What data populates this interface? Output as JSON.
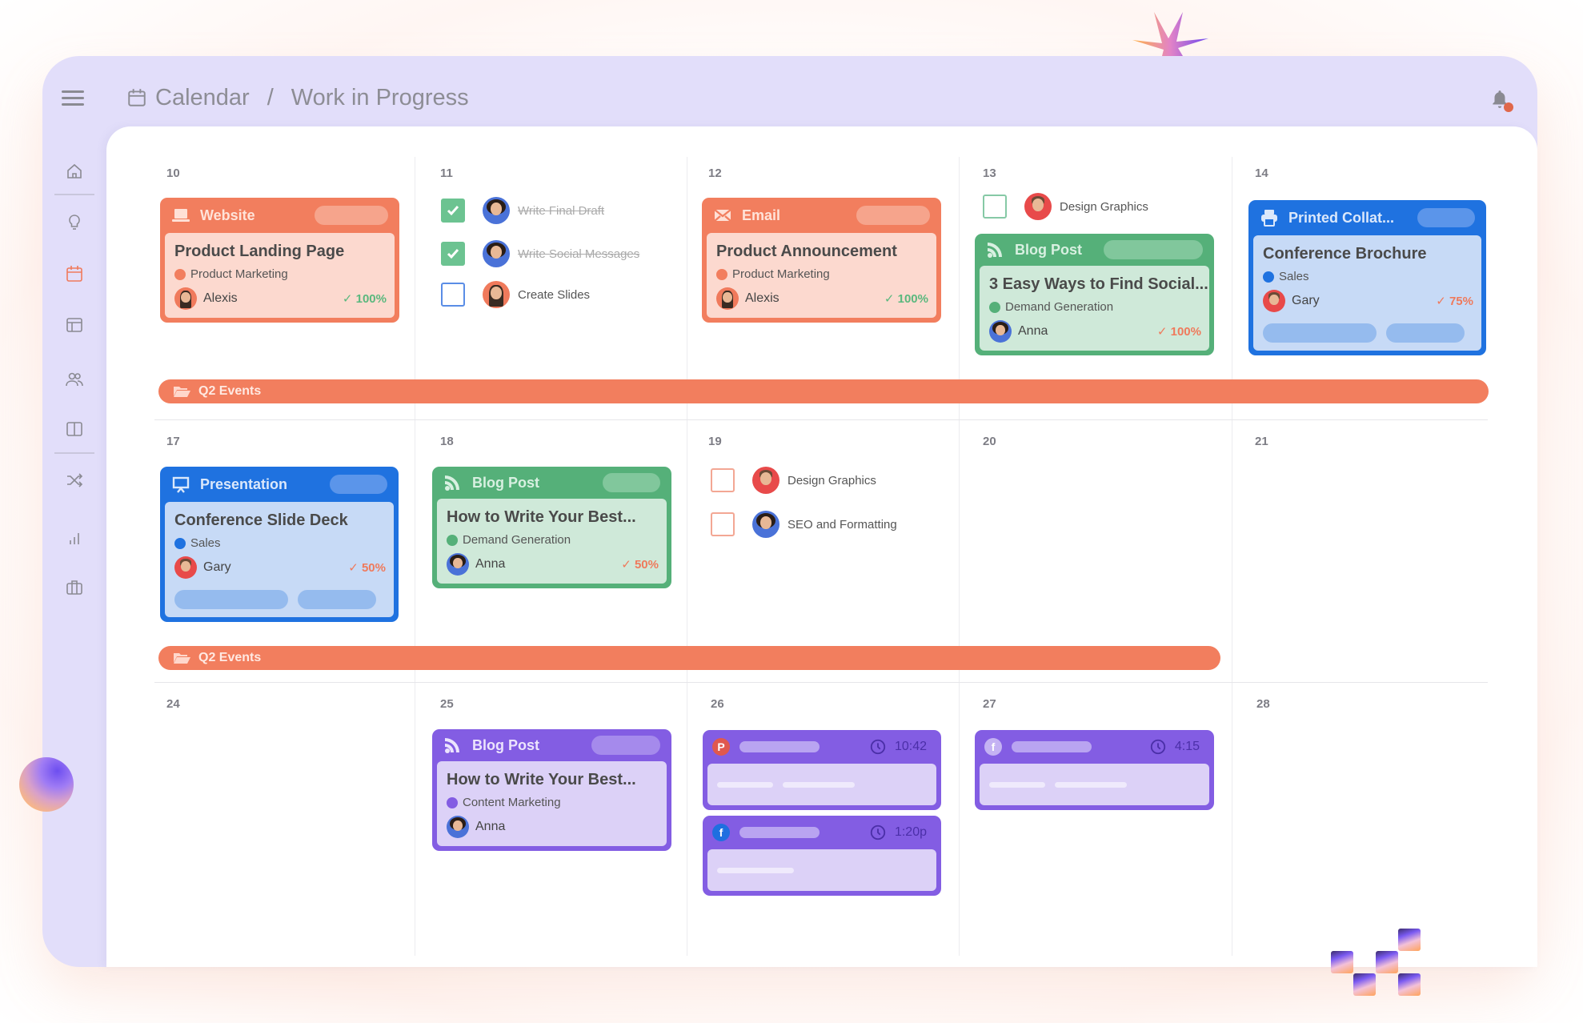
{
  "header": {
    "breadcrumb": [
      "Calendar",
      "Work in Progress"
    ],
    "separator": "/",
    "notification_badge": true
  },
  "sidebar": {
    "items": [
      {
        "icon": "home-icon",
        "active": false
      },
      {
        "icon": "lightbulb-icon",
        "active": false
      },
      {
        "icon": "calendar-icon",
        "active": true
      },
      {
        "icon": "layout-icon",
        "active": false
      },
      {
        "icon": "users-icon",
        "active": false
      },
      {
        "icon": "columns-icon",
        "active": false
      },
      {
        "icon": "shuffle-icon",
        "active": false
      },
      {
        "icon": "bar-chart-icon",
        "active": false
      },
      {
        "icon": "briefcase-icon",
        "active": false
      }
    ]
  },
  "colors": {
    "accent": "#f27e5e",
    "website": "#f27e5e",
    "blog_green": "#55b079",
    "printed_blue": "#1f72e0",
    "purple": "#835de3",
    "sidebar_bg": "#e2defa"
  },
  "calendar": {
    "weeks": [
      {
        "days": [
          "10",
          "11",
          "12",
          "13",
          "14"
        ],
        "event_bar": "Q2 Events"
      },
      {
        "days": [
          "17",
          "18",
          "19",
          "20",
          "21"
        ],
        "event_bar": "Q2 Events"
      },
      {
        "days": [
          "24",
          "25",
          "26",
          "27",
          "28"
        ]
      }
    ],
    "cards": {
      "d10": {
        "type": "Website",
        "title": "Product Landing Page",
        "tag": "Product Marketing",
        "owner": "Alexis",
        "progress": "100%"
      },
      "d12": {
        "type": "Email",
        "title": "Product Announcement",
        "tag": "Product Marketing",
        "owner": "Alexis",
        "progress": "100%"
      },
      "d13": {
        "type": "Blog Post",
        "title": "3 Easy Ways to Find Social...",
        "tag": "Demand Generation",
        "owner": "Anna",
        "progress": "100%"
      },
      "d14": {
        "type": "Printed Collat...",
        "title": "Conference Brochure",
        "tag": "Sales",
        "owner": "Gary",
        "progress": "75%"
      },
      "d17": {
        "type": "Presentation",
        "title": "Conference Slide Deck",
        "tag": "Sales",
        "owner": "Gary",
        "progress": "50%"
      },
      "d18": {
        "type": "Blog Post",
        "title": "How to Write Your Best...",
        "tag": "Demand Generation",
        "owner": "Anna",
        "progress": "50%"
      },
      "d25": {
        "type": "Blog Post",
        "title": "How to Write Your Best...",
        "tag": "Content Marketing",
        "owner": "Anna"
      }
    },
    "todos": {
      "d11": [
        {
          "label": "Write Final Draft",
          "done": true,
          "owner": "Anna"
        },
        {
          "label": "Write Social Messages",
          "done": true,
          "owner": "Anna"
        },
        {
          "label": "Create Slides",
          "done": false,
          "owner": "Alexis"
        }
      ],
      "d13": [
        {
          "label": "Design Graphics",
          "done": false,
          "owner": "Gary"
        }
      ],
      "d19": [
        {
          "label": "Design Graphics",
          "done": false,
          "owner": "Gary"
        },
        {
          "label": "SEO and Formatting",
          "done": false,
          "owner": "Anna"
        }
      ]
    },
    "social_posts": {
      "d26": [
        {
          "network": "pinterest",
          "icon_glyph": "P",
          "time": "10:42"
        },
        {
          "network": "facebook",
          "icon_glyph": "f",
          "time": "1:20p"
        }
      ],
      "d27": [
        {
          "network": "facebook",
          "icon_glyph": "f",
          "time": "4:15"
        }
      ]
    }
  }
}
